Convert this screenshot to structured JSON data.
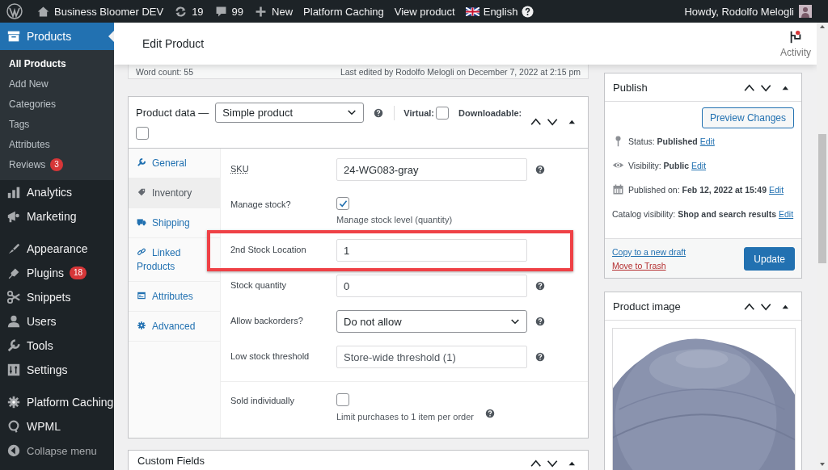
{
  "admin_bar": {
    "items": [
      {
        "kind": "wp-logo"
      },
      {
        "kind": "home",
        "label": "Business Bloomer DEV"
      },
      {
        "kind": "updates",
        "label": "19"
      },
      {
        "kind": "comments",
        "label": "99"
      },
      {
        "kind": "new",
        "label": "New"
      },
      {
        "kind": "link",
        "label": "Platform Caching"
      },
      {
        "kind": "link",
        "label": "View product"
      },
      {
        "kind": "language",
        "label": "English"
      }
    ],
    "greeting": "Howdy, Rodolfo Melogli"
  },
  "sidebar": {
    "menu": [
      {
        "kind": "products",
        "label": "Products",
        "selected": true,
        "children": [
          {
            "label": "All Products",
            "selected": true
          },
          {
            "label": "Add New",
            "selected": false
          },
          {
            "label": "Categories",
            "selected": false
          },
          {
            "label": "Tags",
            "selected": false
          },
          {
            "label": "Attributes",
            "selected": false
          },
          {
            "label": "Reviews",
            "selected": false,
            "badge": "3"
          }
        ]
      },
      {
        "kind": "analytics",
        "label": "Analytics",
        "selected": false
      },
      {
        "kind": "marketing",
        "label": "Marketing",
        "selected": false
      },
      {
        "kind": "separator"
      },
      {
        "kind": "appearance",
        "label": "Appearance",
        "selected": false
      },
      {
        "kind": "plugins",
        "label": "Plugins",
        "selected": false,
        "badge": "18"
      },
      {
        "kind": "snippets",
        "label": "Snippets",
        "selected": false
      },
      {
        "kind": "users",
        "label": "Users",
        "selected": false
      },
      {
        "kind": "tools",
        "label": "Tools",
        "selected": false
      },
      {
        "kind": "settings",
        "label": "Settings",
        "selected": false
      },
      {
        "kind": "separator"
      },
      {
        "kind": "caching",
        "label": "Platform Caching",
        "selected": false
      },
      {
        "kind": "wpml",
        "label": "WPML",
        "selected": false
      }
    ],
    "collapse": "Collapse menu"
  },
  "header": {
    "title": "Edit Product",
    "activity": "Activity"
  },
  "editor_status": {
    "word_count": "Word count: 55",
    "last_edited": "Last edited by Rodolfo Melogli on December 7, 2022 at 2:15 pm"
  },
  "product_data": {
    "title": "Product data —",
    "product_type": "Simple product",
    "virtual_label": "Virtual:",
    "virtual": false,
    "downloadable_label": "Downloadable:",
    "downloadable": false,
    "tabs": [
      {
        "kind": "general",
        "label": "General",
        "selected": false
      },
      {
        "kind": "inventory",
        "label": "Inventory",
        "selected": true
      },
      {
        "kind": "shipping",
        "label": "Shipping",
        "selected": false
      },
      {
        "kind": "linked",
        "label": "Linked Products",
        "selected": false
      },
      {
        "kind": "attributes",
        "label": "Attributes",
        "selected": false
      },
      {
        "kind": "advanced",
        "label": "Advanced",
        "selected": false
      }
    ],
    "fields": [
      {
        "kind": "text",
        "label": "SKU",
        "abbreviated": true,
        "value": "24-WG083-gray",
        "help": true,
        "highlighted": false,
        "separated": false
      },
      {
        "kind": "checkbox",
        "label": "Manage stock?",
        "abbreviated": false,
        "checked": true,
        "description": "Manage stock level (quantity)",
        "help": false,
        "highlighted": false,
        "separated": false
      },
      {
        "kind": "text",
        "label": "2nd Stock Location",
        "abbreviated": false,
        "value": "1",
        "help": false,
        "highlighted": true,
        "separated": false
      },
      {
        "kind": "text",
        "label": "Stock quantity",
        "abbreviated": false,
        "value": "0",
        "help": true,
        "highlighted": false,
        "separated": false
      },
      {
        "kind": "select",
        "label": "Allow backorders?",
        "abbreviated": false,
        "value": "Do not allow",
        "help": true,
        "highlighted": false,
        "separated": false
      },
      {
        "kind": "text",
        "label": "Low stock threshold",
        "abbreviated": false,
        "placeholder": "Store-wide threshold (1)",
        "help": true,
        "highlighted": false,
        "separated": false
      },
      {
        "kind": "checkbox",
        "label": "Sold individually",
        "abbreviated": false,
        "checked": false,
        "description": "Limit purchases to 1 item per order",
        "help": true,
        "highlighted": false,
        "separated": true
      }
    ]
  },
  "custom_fields": {
    "title": "Custom Fields"
  },
  "publish": {
    "title": "Publish",
    "preview": "Preview Changes",
    "rows": [
      {
        "kind": "status",
        "text": "Status: **Published**",
        "link": "Edit"
      },
      {
        "kind": "visibility",
        "text": "Visibility: **Public**",
        "link": "Edit"
      },
      {
        "kind": "date",
        "text": "Published on: **Feb 12, 2022 at 15:49**",
        "link": "Edit"
      },
      {
        "kind": "catalog",
        "text": "Catalog visibility: **Shop and search results**",
        "link": "Edit"
      }
    ],
    "copy_link": "Copy to a new draft",
    "trash_link": "Move to Trash",
    "update": "Update"
  },
  "product_image": {
    "title": "Product image",
    "kind": "picture"
  }
}
